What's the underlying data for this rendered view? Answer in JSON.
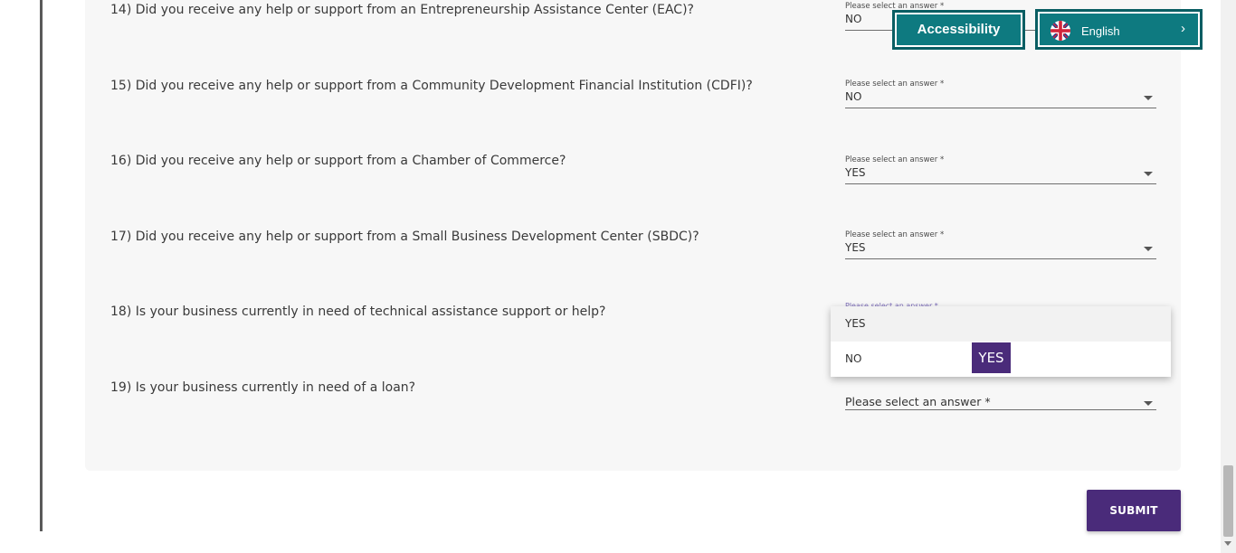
{
  "questions": [
    {
      "text": "14) Did you receive any help or support from an Entrepreneurship Assistance Center (EAC)?",
      "hint": "Please select an answer *",
      "value": "NO"
    },
    {
      "text": "15) Did you receive any help or support from a Community Development Financial Institution (CDFI)?",
      "hint": "Please select an answer *",
      "value": "NO"
    },
    {
      "text": "16) Did you receive any help or support from a Chamber of Commerce?",
      "hint": "Please select an answer *",
      "value": "YES"
    },
    {
      "text": "17) Did you receive any help or support from a Small Business Development Center (SBDC)?",
      "hint": "Please select an answer *",
      "value": "YES"
    },
    {
      "text": "18) Is your business currently in need of technical assistance support or help?",
      "hint": "Please select an answer *"
    },
    {
      "text": "19) Is your business currently in need of a loan?",
      "placeholder": "Please select an answer *"
    }
  ],
  "dropdown": {
    "options": [
      "YES",
      "NO"
    ],
    "tooltip": "YES"
  },
  "widgets": {
    "accessibility_label": "Accessibility",
    "language_label": "English"
  },
  "submit_label": "SUBMIT",
  "colors": {
    "accent_teal": "#0e7a80",
    "submit_purple": "#4a2b7a"
  }
}
